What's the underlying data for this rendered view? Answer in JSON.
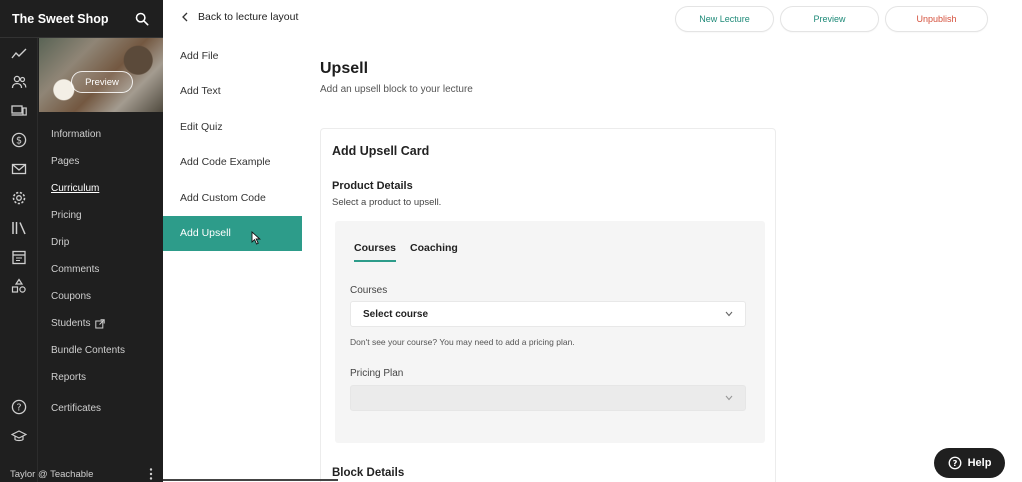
{
  "sidebar": {
    "school_name": "The Sweet Shop",
    "search_icon": "search-icon",
    "rail_icons": [
      "trend-icon",
      "users-icon",
      "devices-icon",
      "dollar-icon",
      "mail-icon",
      "gear-icon",
      "library-icon",
      "calendar-icon",
      "shapes-icon",
      "help-circle-icon",
      "graduation-cap-icon"
    ],
    "course_preview_label": "Preview",
    "nav_items": [
      {
        "label": "Information",
        "active": false
      },
      {
        "label": "Pages",
        "active": false
      },
      {
        "label": "Curriculum",
        "active": true
      },
      {
        "label": "Pricing",
        "active": false
      },
      {
        "label": "Drip",
        "active": false
      },
      {
        "label": "Comments",
        "active": false
      },
      {
        "label": "Coupons",
        "active": false
      },
      {
        "label": "Students",
        "active": false,
        "external": true
      },
      {
        "label": "Bundle Contents",
        "active": false
      },
      {
        "label": "Reports",
        "active": false
      },
      {
        "label": "Certificates",
        "active": false
      }
    ],
    "user_label": "Taylor @ Teachable"
  },
  "topbar": {
    "back_label": "Back to lecture layout",
    "new_lecture_label": "New Lecture",
    "preview_label": "Preview",
    "unpublish_label": "Unpublish"
  },
  "blocks": {
    "items": [
      {
        "label": "Add File"
      },
      {
        "label": "Add Text"
      },
      {
        "label": "Edit Quiz"
      },
      {
        "label": "Add Code Example"
      },
      {
        "label": "Add Custom Code"
      },
      {
        "label": "Add Upsell"
      }
    ],
    "active_index": 5
  },
  "main": {
    "title": "Upsell",
    "subtitle": "Add an upsell block to your lecture",
    "card": {
      "title": "Add Upsell Card",
      "product_details_title": "Product Details",
      "product_details_sub": "Select a product to upsell.",
      "tabs": [
        {
          "label": "Courses",
          "active": true
        },
        {
          "label": "Coaching",
          "active": false
        }
      ],
      "courses_label": "Courses",
      "course_select_value": "Select course",
      "course_hint": "Don't see your course? You may need to add a pricing plan.",
      "pricing_plan_label": "Pricing Plan",
      "pricing_plan_value": "",
      "block_details_title": "Block Details"
    }
  },
  "help_label": "Help",
  "colors": {
    "accent": "#2d9c8a",
    "danger": "#d5503c",
    "sidebar_bg": "#1f1f1f"
  }
}
